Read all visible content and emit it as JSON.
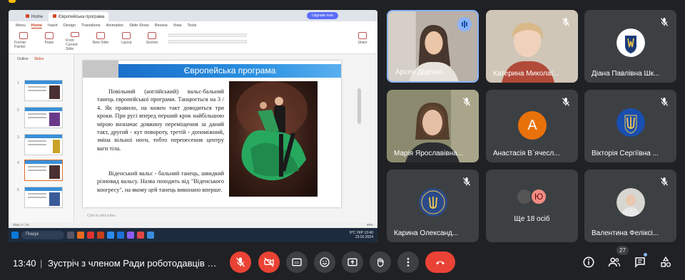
{
  "shared_screen": {
    "browser_tabs": [
      "Home",
      "Європейська програма"
    ],
    "upgrade_label": "Upgrade now",
    "ribbon_tabs": [
      "Menu",
      "Home",
      "Insert",
      "Design",
      "Transitions",
      "Animation",
      "Slide Show",
      "Review",
      "View",
      "Tools"
    ],
    "ribbon_buttons": [
      "Format Painter",
      "Paste",
      "From Current Slide",
      "New Slide",
      "Layout",
      "Section",
      "Share"
    ],
    "outline_tabs": [
      "Outline",
      "Slides"
    ],
    "slide_numbers": [
      "1",
      "2",
      "3",
      "4",
      "5"
    ],
    "slide_title": "Європейська програма",
    "paragraph1": "Повільний (англійський) вальс-бальний танець європейської програми. Танцюється на 3 / 4. Як правило, на кожен такт доводиться три кроки. При русі вперед перший крок найбільшою мірою визначає довжину переміщення за даний такт, другий - кут повороту, третій - допоміжний, зміна вільної ноги, тобто перенесення центру ваги тіла.",
    "paragraph2": "Віденський вальс - бальний танець, швидкий різновид вальсу. Назва походить від \"Віденського конгресу\", на якому цей танець виконано вперше.",
    "notes_placeholder": "Click to add notes",
    "status_text": "Slide 4 / 10",
    "taskbar_search": "Пошук",
    "tray_temp": "9°C",
    "tray_lang": "УКР",
    "tray_time": "13:40",
    "tray_date": "23.02.2024",
    "zoom": "89%"
  },
  "participants": [
    {
      "name": "Арсен Діденко",
      "state": "speaking"
    },
    {
      "name": "Катерина Миколаї...",
      "state": "muted"
    },
    {
      "name": "Діана Павлівна Шк...",
      "state": "muted"
    },
    {
      "name": "Марія Ярославівна...",
      "state": "muted"
    },
    {
      "name": "Анастасія В`ячесл...",
      "state": "muted",
      "initial": "А"
    },
    {
      "name": "Вікторія Сергіївна ...",
      "state": "muted"
    },
    {
      "name": "Карина Олександ...",
      "state": "muted"
    },
    {
      "name": "Ще 18 осіб",
      "initial": "Ю"
    },
    {
      "name": "Валентина Феліксі...",
      "state": "muted"
    }
  ],
  "controls": {
    "time": "13:40",
    "separator": "|",
    "meeting_title": "Зустріч з членом Ради роботодавців Єв...",
    "participant_count": "27"
  },
  "colors": {
    "background": "#202124",
    "tile": "#3c4043",
    "danger": "#ea4335",
    "accent": "#8ab4f8",
    "avatar_orange": "#e8710a"
  }
}
